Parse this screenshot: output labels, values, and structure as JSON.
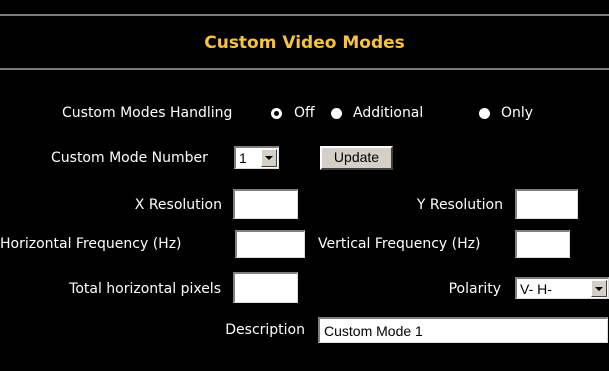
{
  "header": {
    "title": "Custom Video Modes"
  },
  "handling": {
    "label": "Custom Modes Handling",
    "options": [
      {
        "label": "Off",
        "checked": true
      },
      {
        "label": "Additional",
        "checked": false
      },
      {
        "label": "Only",
        "checked": false
      }
    ]
  },
  "mode_number": {
    "label": "Custom Mode Number",
    "value": "1"
  },
  "update_button": "Update",
  "x_resolution": {
    "label": "X Resolution",
    "value": ""
  },
  "y_resolution": {
    "label": "Y Resolution",
    "value": ""
  },
  "h_frequency": {
    "label": "Horizontal Frequency (Hz)",
    "value": ""
  },
  "v_frequency": {
    "label": "Vertical Frequency (Hz)",
    "value": ""
  },
  "total_h_pixels": {
    "label": "Total horizontal pixels",
    "value": ""
  },
  "polarity": {
    "label": "Polarity",
    "value": "V- H-"
  },
  "description": {
    "label": "Description",
    "value": "Custom Mode 1"
  },
  "colors": {
    "background": "#000000",
    "title": "#f5c243",
    "rule": "#7a7a7a"
  }
}
